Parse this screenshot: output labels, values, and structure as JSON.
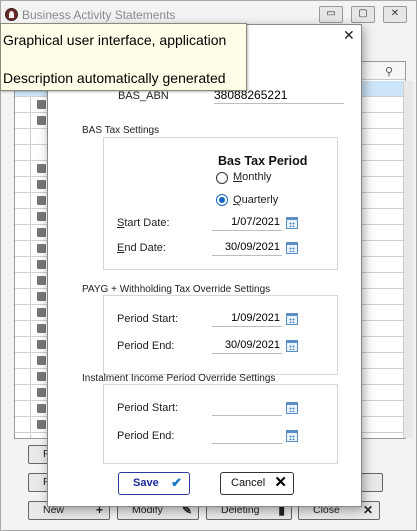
{
  "background": {
    "title": "Business Activity Statements",
    "search_icon": "search-icon",
    "buttons": {
      "new": "New",
      "modify": "Modify",
      "deleting": "Deleting",
      "close": "Close",
      "pr1": "Pr",
      "pr2": "Pr"
    }
  },
  "tooltip": {
    "line1": "Graphical user interface, application",
    "line2": "Description automatically generated"
  },
  "dialog": {
    "abn_label": "BAS_ABN",
    "abn_value": "38088265221",
    "bas_group_title": "BAS Tax Settings",
    "bas_period_heading": "Bas Tax Period",
    "monthly_label": "Monthly",
    "quarterly_label": "Quarterly",
    "selected_period": "Quarterly",
    "start_date_label": "Start Date:",
    "start_date_value": "1/07/2021",
    "end_date_label": "End Date:",
    "end_date_value": "30/09/2021",
    "payg_group_title": "PAYG + Withholding Tax Override Settings",
    "payg_start_label": "Period Start:",
    "payg_start_value": "1/09/2021",
    "payg_end_label": "Period End:",
    "payg_end_value": "30/09/2021",
    "inst_group_title": "Instalment Income Period Override Settings",
    "inst_start_label": "Period Start:",
    "inst_start_value": "",
    "inst_end_label": "Period End:",
    "inst_end_value": "",
    "save_label": "Save",
    "cancel_label": "Cancel"
  }
}
